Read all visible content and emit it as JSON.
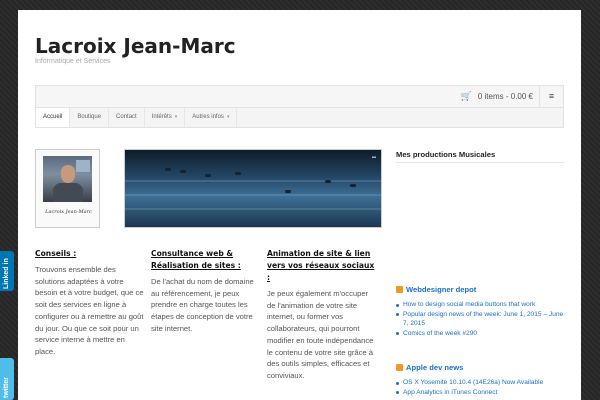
{
  "site": {
    "title": "Lacroix Jean-Marc",
    "description": "Informatique et Services"
  },
  "cart": {
    "label": "0 items - 0.00 €",
    "icon": "cart-icon"
  },
  "rss_button_icon": "rss-icon",
  "nav": {
    "items": [
      {
        "label": "Accueil",
        "active": true
      },
      {
        "label": "Boutique"
      },
      {
        "label": "Contact"
      },
      {
        "label": "Intérêts",
        "dropdown": true
      },
      {
        "label": "Autres infos",
        "dropdown": true
      }
    ]
  },
  "avatar": {
    "signature": "Lacroix Jean-Marc"
  },
  "columns": [
    {
      "title": "Conseils :",
      "text": "Trouvons ensemble des solutions adaptées à votre besoin et à votre budget, que ce soit des services en ligne à configurer ou à remettre au goût du jour. Ou que ce soit pour un service interne à mettre en place."
    },
    {
      "title": "Consultance web & Réalisation de sites :",
      "text": "De l'achat du nom de domaine au référencement, je peux prendre en charge toutes les étapes de conception de votre site internet."
    },
    {
      "title": "Animation de site & lien vers vos réseaux sociaux :",
      "text": "Je peux également m'occuper de l'animation de votre site internet, ou former vos collaborateurs, qui pourront modifier en toute indépendance le contenu de votre site grâce à des outils simples, efficaces  et conviviaux."
    }
  ],
  "sidebar": {
    "heading": "Mes productions Musicales",
    "feeds": [
      {
        "title": "Webdesigner depot",
        "items": [
          "How to design social media buttons that work",
          "Popular design news of the week: June 1, 2015 – June 7, 2015",
          "Comics of the week #290"
        ]
      },
      {
        "title": "Apple dev news",
        "items": [
          "OS X Yosemite 10.10.4 (14E26a) Now Available",
          "App Analytics in iTunes Connect"
        ]
      }
    ]
  },
  "social": {
    "linkedin": "Linked in",
    "twitter": "twitter"
  }
}
